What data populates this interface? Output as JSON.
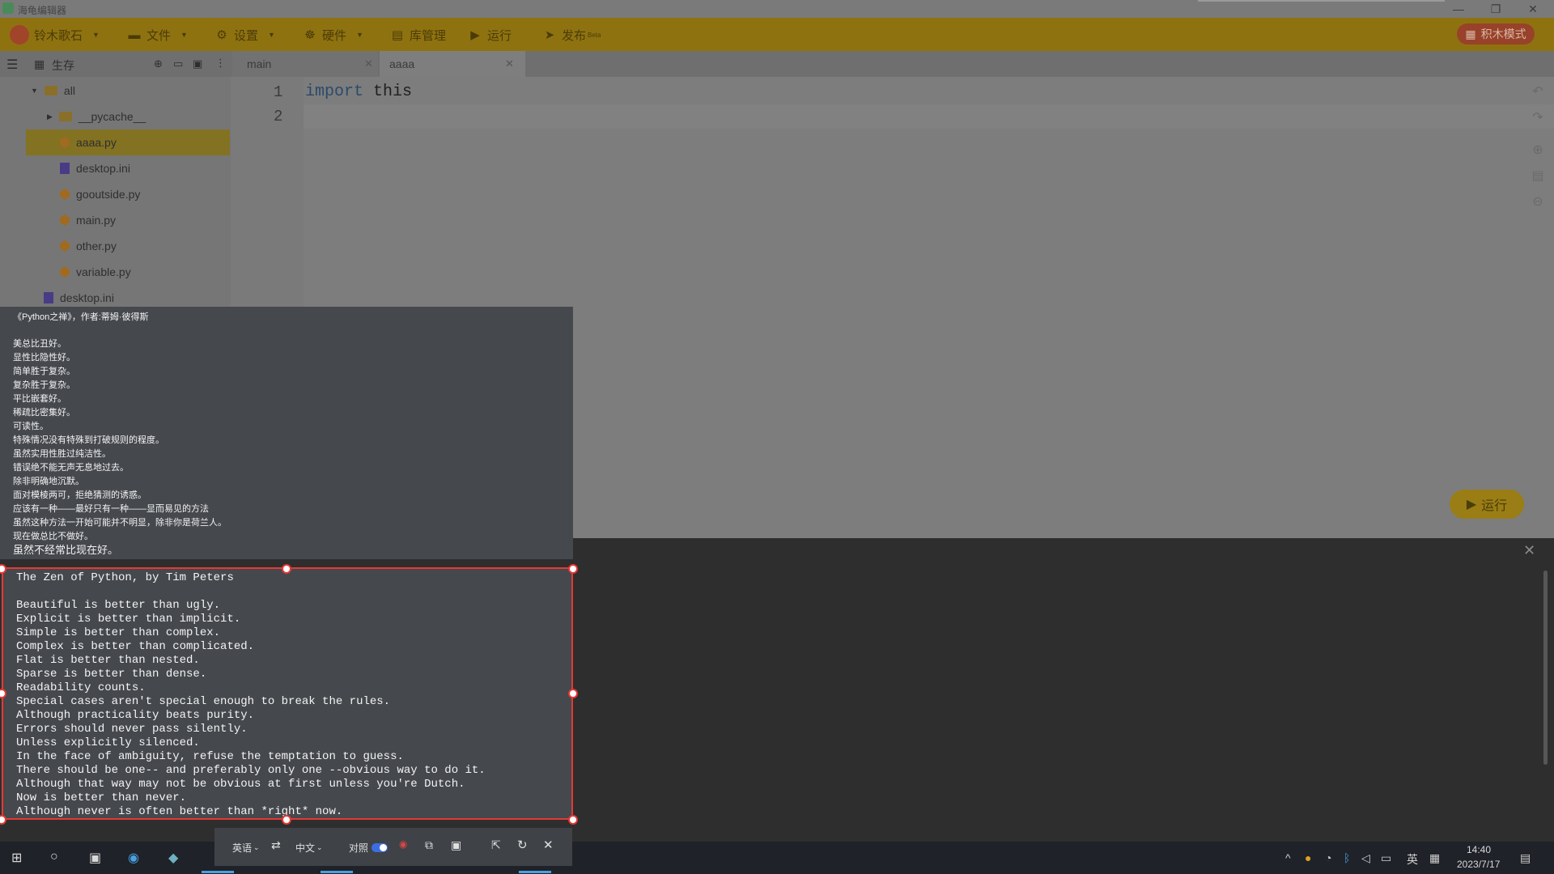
{
  "window": {
    "title": "海龟编辑器",
    "controls": [
      "—",
      "❐",
      "✕"
    ]
  },
  "toolbar": {
    "user": "铃木歌石",
    "file": "文件",
    "settings": "设置",
    "hardware": "硬件",
    "library": "库管理",
    "run": "运行",
    "publish": "发布",
    "publish_badge": "Beta",
    "block_mode": "积木模式"
  },
  "sidebar": {
    "header": "生存",
    "tree": [
      {
        "label": "all",
        "type": "folder"
      },
      {
        "label": "__pycache__",
        "type": "folder"
      },
      {
        "label": "aaaa.py",
        "type": "py",
        "selected": true
      },
      {
        "label": "desktop.ini",
        "type": "ini"
      },
      {
        "label": "gooutside.py",
        "type": "py"
      },
      {
        "label": "main.py",
        "type": "py"
      },
      {
        "label": "other.py",
        "type": "py"
      },
      {
        "label": "variable.py",
        "type": "py"
      },
      {
        "label": "desktop.ini",
        "type": "ini"
      }
    ]
  },
  "tabs": [
    {
      "label": "main",
      "active": false
    },
    {
      "label": "aaaa",
      "active": true
    }
  ],
  "editor": {
    "lines": [
      {
        "num": "1",
        "keyword": "import",
        "rest": " this"
      },
      {
        "num": "2",
        "keyword": "",
        "rest": ""
      }
    ],
    "run_button": "运行"
  },
  "translation": {
    "title": "《Python之禅》，作者:蒂姆·彼得斯",
    "lines": [
      "美总比丑好。",
      "显性比隐性好。",
      "简单胜于复杂。",
      "复杂胜于复杂。",
      " 平比嵌套好。",
      "稀疏比密集好。",
      "可读性。",
      "特殊情况没有特殊到打破规则的程度。",
      "虽然实用性胜过纯洁性。",
      "错误绝不能无声无息地过去。",
      "除非明确地沉默。",
      "面对模棱两可，拒绝猜测的诱惑。",
      "应该有一种——最好只有一种——显而易见的方法",
      "虽然这种方法一开始可能并不明显，除非你是荷兰人。",
      "现在做总比不做好。",
      "虽然不经常比现在好。"
    ]
  },
  "source_text": {
    "title": "The Zen of Python, by Tim Peters",
    "lines": [
      "Beautiful is better than ugly.",
      "Explicit is better than implicit.",
      "Simple is better than complex.",
      "Complex is better than complicated.",
      "Flat is better than nested.",
      "Sparse is better than dense.",
      "Readability counts.",
      "Special cases aren't special enough to break the rules.",
      "Although practicality beats purity.",
      "Errors should never pass silently.",
      "Unless explicitly silenced.",
      "In the face of ambiguity, refuse the temptation to guess.",
      "There should be one-- and preferably only one --obvious way to do it.",
      "Although that way may not be obvious at first unless you're Dutch.",
      "Now is better than never.",
      "Although never is often better than *right* now."
    ]
  },
  "translate_toolbar": {
    "source_lang": "英语",
    "target_lang": "中文",
    "compare_label": "对照",
    "compare_on": true
  },
  "taskbar": {
    "time": "14:40",
    "date": "2023/7/17",
    "ime_lang": "英"
  },
  "colors": {
    "toolbar": "#8f7210",
    "selection": "#e53935",
    "block_mode": "#98422a"
  }
}
